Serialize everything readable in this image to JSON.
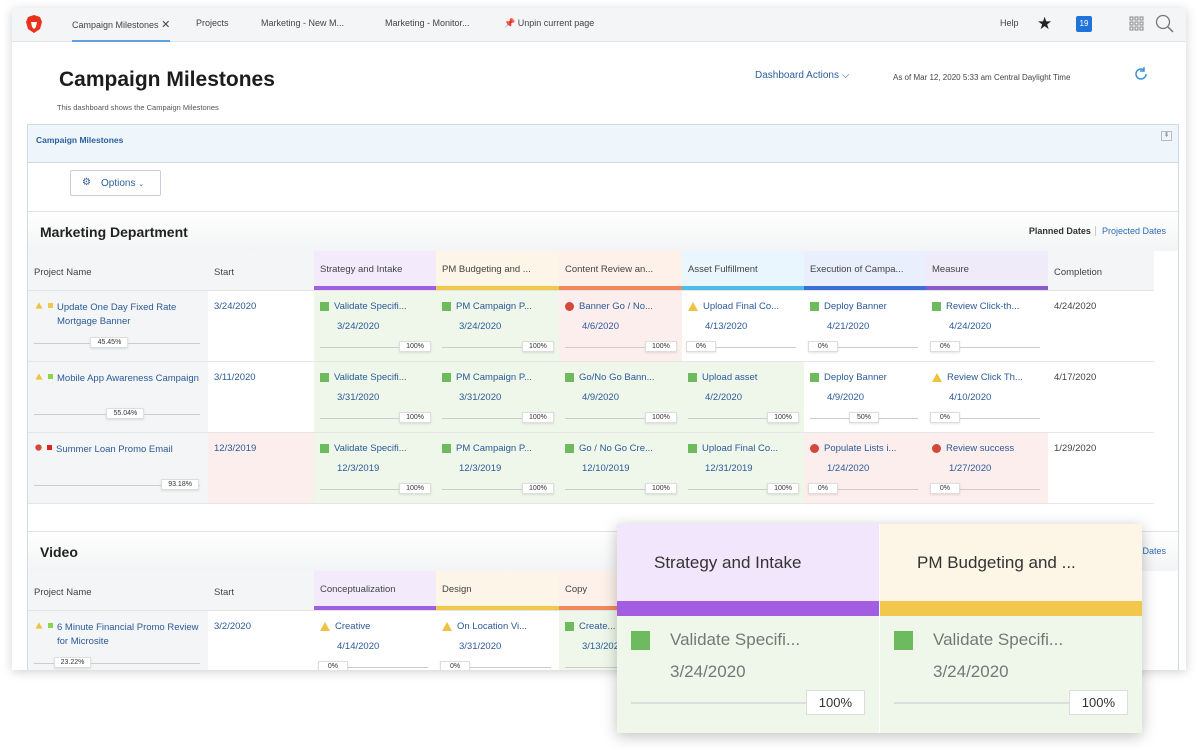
{
  "nav": {
    "tabs": [
      "Campaign Milestones",
      "Projects",
      "Marketing - New M...",
      "Marketing - Monitor..."
    ],
    "unpin": "Unpin current page",
    "help": "Help",
    "notifications": "19"
  },
  "header": {
    "title": "Campaign Milestones",
    "subtitle": "This dashboard shows the Campaign Milestones",
    "dashboard_actions": "Dashboard Actions",
    "as_of": "As of  Mar 12, 2020 5:33 am Central Daylight Time"
  },
  "panel": {
    "title": "Campaign Milestones",
    "options": "Options"
  },
  "colors": {
    "accent": "#2b5f9e",
    "green": "#6dbb5e",
    "red": "#d2483b",
    "yellow": "#efc23f"
  },
  "sections": [
    {
      "title": "Marketing Department",
      "planned": "Planned Dates",
      "projected": "Projected Dates",
      "columns": [
        {
          "label": "Project Name"
        },
        {
          "label": "Start"
        },
        {
          "label": "Strategy and Intake",
          "color": "#a35de0",
          "bg": "#f3ebfb"
        },
        {
          "label": "PM Budgeting and ...",
          "color": "#f1c84b",
          "bg": "#fdf6e8"
        },
        {
          "label": "Content Review an...",
          "color": "#f08a5d",
          "bg": "#fdf1ea"
        },
        {
          "label": "Asset Fulfillment",
          "color": "#4dbce9",
          "bg": "#eaf6fd"
        },
        {
          "label": "Execution of Campa...",
          "color": "#3a6fd8",
          "bg": "#e9effc"
        },
        {
          "label": "Measure",
          "color": "#8a5cc8",
          "bg": "#f0ebf8"
        },
        {
          "label": "Completion"
        }
      ],
      "rows": [
        {
          "status": "y",
          "flag": "#f1c84b",
          "name": "Update One Day Fixed Rate Mortgage Banner",
          "progress": "45.45%",
          "start": "3/24/2020",
          "start_late": false,
          "tasks": [
            [
              "g",
              "Validate Specifi...",
              "3/24/2020",
              "100%"
            ],
            [
              "g",
              "PM Campaign P...",
              "3/24/2020",
              "100%"
            ],
            [
              "r",
              "Banner Go / No...",
              "4/6/2020",
              "100%"
            ],
            [
              "y",
              "Upload Final Co...",
              "4/13/2020",
              "0%"
            ],
            [
              "g",
              "Deploy Banner",
              "4/21/2020",
              "0%"
            ],
            [
              "g",
              "Review Click-th...",
              "4/24/2020",
              "0%"
            ]
          ],
          "completion": "4/24/2020"
        },
        {
          "status": "y",
          "flag": "#8cd44a",
          "name": "Mobile App Awareness Campaign",
          "progress": "55.04%",
          "start": "3/11/2020",
          "start_late": false,
          "tasks": [
            [
              "g",
              "Validate Specifi...",
              "3/31/2020",
              "100%"
            ],
            [
              "g",
              "PM Campaign P...",
              "3/31/2020",
              "100%"
            ],
            [
              "g",
              "Go/No Go Bann...",
              "4/9/2020",
              "100%"
            ],
            [
              "g",
              "Upload asset",
              "4/2/2020",
              "100%"
            ],
            [
              "g",
              "Deploy Banner",
              "4/9/2020",
              "50%"
            ],
            [
              "y",
              "Review Click Th...",
              "4/10/2020",
              "0%"
            ]
          ],
          "completion": "4/17/2020"
        },
        {
          "status": "r",
          "flag": "#e02020",
          "name": "Summer Loan Promo Email",
          "progress": "93.18%",
          "start": "12/3/2019",
          "start_late": true,
          "tasks": [
            [
              "g",
              "Validate Specifi...",
              "12/3/2019",
              "100%"
            ],
            [
              "g",
              "PM Campaign P...",
              "12/3/2019",
              "100%"
            ],
            [
              "g",
              "Go / No Go Cre...",
              "12/10/2019",
              "100%"
            ],
            [
              "g",
              "Upload Final Co...",
              "12/31/2019",
              "100%"
            ],
            [
              "r",
              "Populate Lists i...",
              "1/24/2020",
              "0%"
            ],
            [
              "r",
              "Review success",
              "1/27/2020",
              "0%"
            ]
          ],
          "completion": "1/29/2020"
        }
      ]
    },
    {
      "title": "Video",
      "planned": "Planned Dates",
      "projected": "Projected Dates",
      "columns": [
        {
          "label": "Project Name"
        },
        {
          "label": "Start"
        },
        {
          "label": "Conceptualization",
          "color": "#a35de0",
          "bg": "#f3ebfb"
        },
        {
          "label": "Design",
          "color": "#f1c84b",
          "bg": "#fdf6e8"
        },
        {
          "label": "Copy",
          "color": "#f08a5d",
          "bg": "#fdf1ea"
        }
      ],
      "rows": [
        {
          "status": "y",
          "flag": "#8cd44a",
          "name": "6 Minute Financial Promo Review for Microsite",
          "progress": "23.22%",
          "start": "3/2/2020",
          "start_late": false,
          "tasks": [
            [
              "y",
              "Creative",
              "4/14/2020",
              "0%"
            ],
            [
              "y",
              "On Location Vi...",
              "3/31/2020",
              "0%"
            ],
            [
              "g",
              "Create...",
              "3/13/2020",
              "100%"
            ]
          ]
        }
      ]
    }
  ],
  "callout": [
    {
      "label": "Strategy and Intake",
      "color": "#a35de0",
      "bg": "#f1e6fb",
      "task": "Validate Specifi...",
      "date": "3/24/2020",
      "progress": "100%"
    },
    {
      "label": "PM Budgeting and ...",
      "color": "#f1c84b",
      "bg": "#fdf5e6",
      "task": "Validate Specifi...",
      "date": "3/24/2020",
      "progress": "100%"
    }
  ]
}
